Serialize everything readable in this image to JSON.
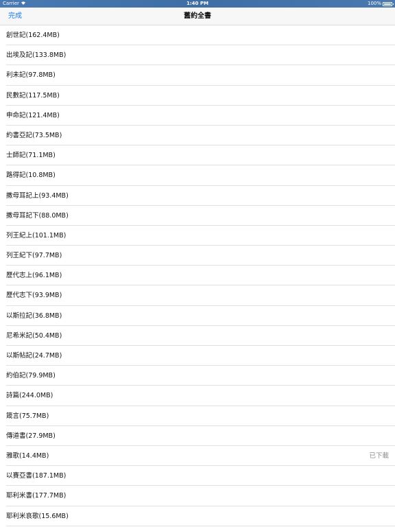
{
  "status_bar": {
    "carrier": "Carrier",
    "time": "1:40 PM",
    "battery": "100%",
    "battery_level": 1.0
  },
  "nav": {
    "done_label": "完成",
    "title": "舊約全書"
  },
  "books": [
    {
      "label": "創世記(162.4MB)",
      "status": ""
    },
    {
      "label": "出埃及記(133.8MB)",
      "status": ""
    },
    {
      "label": "利未記(97.8MB)",
      "status": ""
    },
    {
      "label": "民數記(117.5MB)",
      "status": ""
    },
    {
      "label": "申命記(121.4MB)",
      "status": ""
    },
    {
      "label": "約書亞記(73.5MB)",
      "status": ""
    },
    {
      "label": "士師記(71.1MB)",
      "status": ""
    },
    {
      "label": "路得記(10.8MB)",
      "status": ""
    },
    {
      "label": "撒母耳記上(93.4MB)",
      "status": ""
    },
    {
      "label": "撒母耳記下(88.0MB)",
      "status": ""
    },
    {
      "label": "列王紀上(101.1MB)",
      "status": ""
    },
    {
      "label": "列王紀下(97.7MB)",
      "status": ""
    },
    {
      "label": "歷代志上(96.1MB)",
      "status": ""
    },
    {
      "label": "歷代志下(93.9MB)",
      "status": ""
    },
    {
      "label": "以斯拉記(36.8MB)",
      "status": ""
    },
    {
      "label": "尼希米記(50.4MB)",
      "status": ""
    },
    {
      "label": "以斯帖記(24.7MB)",
      "status": ""
    },
    {
      "label": "約伯記(79.9MB)",
      "status": ""
    },
    {
      "label": "詩篇(244.0MB)",
      "status": ""
    },
    {
      "label": "箴言(75.7MB)",
      "status": ""
    },
    {
      "label": "傳道書(27.9MB)",
      "status": ""
    },
    {
      "label": "雅歌(14.4MB)",
      "status": "已下載"
    },
    {
      "label": "以賽亞書(187.1MB)",
      "status": ""
    },
    {
      "label": "耶利米書(177.7MB)",
      "status": ""
    },
    {
      "label": "耶利米哀歌(15.6MB)",
      "status": ""
    }
  ],
  "colors": {
    "accent": "#1a7cf0",
    "status_bar_bg": "#3f6fa6",
    "separator": "#e0e0e0",
    "secondary_text": "#8e8e93"
  },
  "icons": {
    "wifi": "wifi-icon",
    "battery": "battery-icon"
  }
}
